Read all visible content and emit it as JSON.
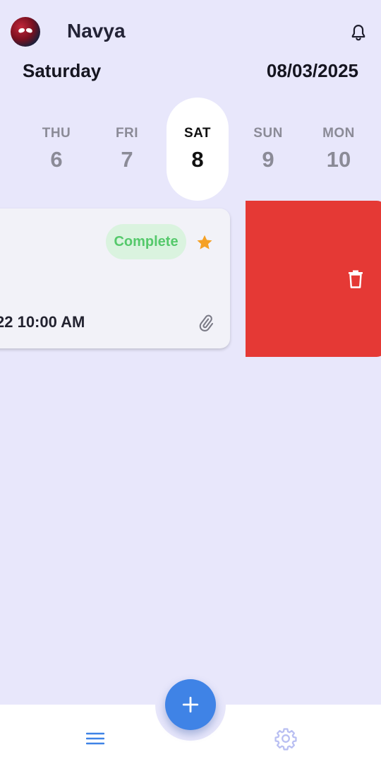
{
  "header": {
    "user_name": "Navya",
    "day_name": "Saturday",
    "full_date": "08/03/2025",
    "icons": {
      "avatar": "user-avatar",
      "notifications": "bell-icon"
    }
  },
  "date_strip": [
    {
      "dow": "THU",
      "dom": "6",
      "selected": false
    },
    {
      "dow": "FRI",
      "dom": "7",
      "selected": false
    },
    {
      "dow": "SAT",
      "dom": "8",
      "selected": true
    },
    {
      "dow": "SUN",
      "dom": "9",
      "selected": false
    },
    {
      "dow": "MON",
      "dom": "10",
      "selected": false
    }
  ],
  "task": {
    "status": "Complete",
    "due": "22 10:00 AM",
    "icons": {
      "favorite": "star-icon",
      "attachment": "paperclip-icon"
    }
  },
  "swipe_action": {
    "icon": "trash-icon",
    "color": "#e53935"
  },
  "bottom_nav": {
    "fab_icon": "plus-icon",
    "left_icon": "menu-icon",
    "right_icon": "gear-icon"
  },
  "colors": {
    "background": "#e8e7fb",
    "accent": "#3f83e6",
    "status_complete_bg": "#daf3df",
    "status_complete_text": "#55c96b",
    "star": "#f5a126",
    "delete": "#e53935"
  }
}
